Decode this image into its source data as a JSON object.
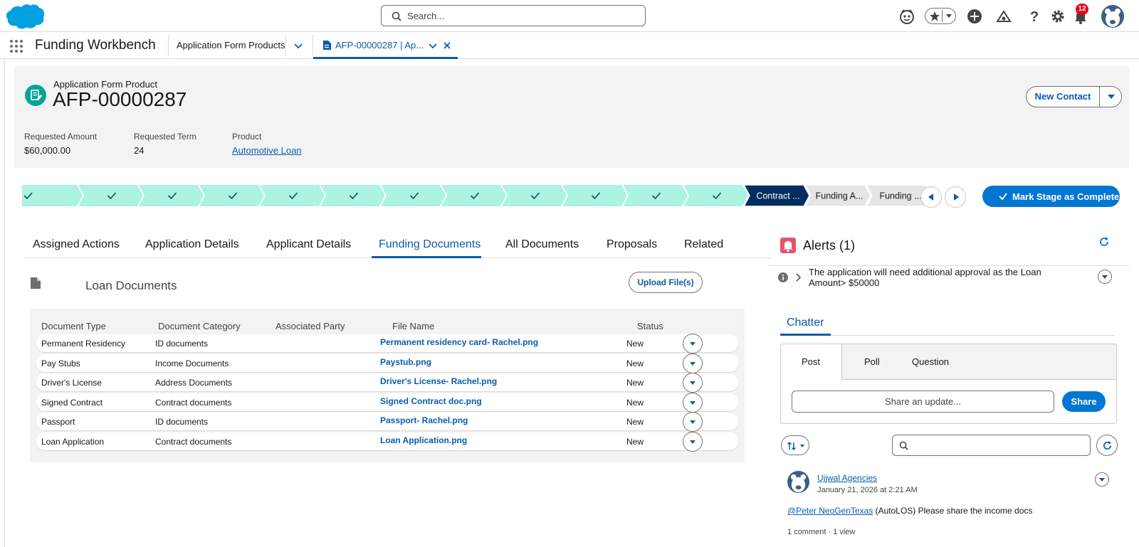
{
  "global_header": {
    "search_placeholder": "Search...",
    "notification_count": "12"
  },
  "nav": {
    "app_name": "Funding Workbench",
    "object_tab_label": "Application Form Products",
    "record_tab_label": "AFP-00000287 | Ap..."
  },
  "record": {
    "object_label": "Application Form Product",
    "title": "AFP-00000287",
    "new_contact_label": "New Contact",
    "fields": [
      {
        "label": "Requested Amount",
        "value": "$60,000.00"
      },
      {
        "label": "Requested Term",
        "value": "24"
      },
      {
        "label": "Product",
        "value": "Automotive Loan"
      }
    ]
  },
  "path": {
    "completed_steps": 12,
    "stages": [
      "Contract ...",
      "Funding A...",
      "Funding ..."
    ],
    "current_stage_index": 0,
    "mark_complete_label": "Mark Stage as Complete"
  },
  "main_tabs": [
    "Assigned Actions",
    "Application Details",
    "Applicant Details",
    "Funding Documents",
    "All Documents",
    "Proposals",
    "Related"
  ],
  "active_tab": "Funding Documents",
  "loan_documents": {
    "title": "Loan Documents",
    "upload_label": "Upload File(s)",
    "columns": [
      "Document Type",
      "Document Category",
      "Associated Party",
      "File Name",
      "Status"
    ],
    "rows": [
      {
        "type": "Permanent Residency",
        "category": "ID documents",
        "party": "",
        "file": "Permanent residency card- Rachel.png",
        "status": "New"
      },
      {
        "type": "Pay Stubs",
        "category": "Income Documents",
        "party": "",
        "file": "Paystub.png",
        "status": "New"
      },
      {
        "type": "Driver's License",
        "category": "Address Documents",
        "party": "",
        "file": "Driver's License- Rachel.png",
        "status": "New"
      },
      {
        "type": "Signed Contract",
        "category": "Contract documents",
        "party": "",
        "file": "Signed Contract doc.png",
        "status": "New"
      },
      {
        "type": "Passport",
        "category": "ID documents",
        "party": "",
        "file": "Passport- Rachel.png",
        "status": "New"
      },
      {
        "type": "Loan Application",
        "category": "Contract documents",
        "party": "",
        "file": "Loan Application.png",
        "status": "New"
      }
    ]
  },
  "alerts": {
    "title": "Alerts (1)",
    "items": [
      {
        "text": "The application will need additional approval as the Loan Amount> $50000"
      }
    ]
  },
  "chatter": {
    "tab_label": "Chatter",
    "publisher_tabs": [
      "Post",
      "Poll",
      "Question"
    ],
    "share_placeholder": "Share an update...",
    "share_label": "Share",
    "post": {
      "author": "Ujjwal Agencies",
      "date": "January 21, 2026 at 2:21 AM",
      "mention": "@Peter NeoGenTexas",
      "body_rest": " (AutoLOS) Please share the income docs",
      "meta": "1 comment  ·  1 view"
    }
  },
  "colors": {
    "brand_blue": "#0176d3",
    "link_blue": "#0b5cab",
    "path_complete": "#acf3e4",
    "path_current": "#032d60",
    "path_incomplete": "#e5e5e5",
    "alert_red": "#e3566b"
  }
}
